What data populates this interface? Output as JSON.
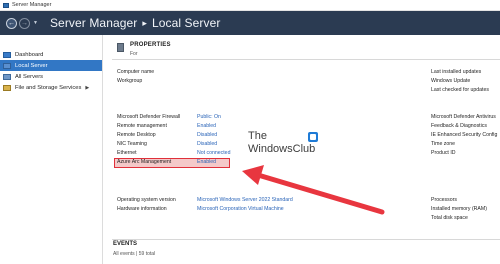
{
  "window": {
    "title": "Server Manager"
  },
  "header": {
    "back_icon": "back-arrow-icon",
    "forward_icon": "forward-arrow-icon",
    "breadcrumb_root": "Server Manager",
    "breadcrumb_sep": "▸",
    "breadcrumb_current": "Local Server",
    "band_color": "#2b3b52"
  },
  "sidebar": {
    "items": [
      {
        "label": "Dashboard",
        "icon": "dashboard-icon",
        "active": false
      },
      {
        "label": "Local Server",
        "icon": "local-server-icon",
        "active": true
      },
      {
        "label": "All Servers",
        "icon": "all-servers-icon",
        "active": false
      },
      {
        "label": "File and Storage Services",
        "icon": "file-storage-icon",
        "active": false,
        "has_chevron": true
      }
    ],
    "active_color": "#3277c5"
  },
  "properties": {
    "title": "PROPERTIES",
    "subtitle": "For",
    "left_rows_top": [
      {
        "label": "Computer name",
        "value": ""
      },
      {
        "label": "Workgroup",
        "value": ""
      }
    ],
    "left_rows_mid": [
      {
        "label": "Microsoft Defender Firewall",
        "value": "Public: On"
      },
      {
        "label": "Remote management",
        "value": "Enabled"
      },
      {
        "label": "Remote Desktop",
        "value": "Disabled"
      },
      {
        "label": "NIC Teaming",
        "value": "Disabled"
      },
      {
        "label": "Ethernet",
        "value": "Not connected"
      },
      {
        "label": "Azure Arc Management",
        "value": "Enabled"
      }
    ],
    "left_rows_bottom": [
      {
        "label": "Operating system version",
        "value": "Microsoft Windows Server 2022 Standard"
      },
      {
        "label": "Hardware information",
        "value": "Microsoft Corporation Virtual Machine"
      }
    ],
    "right_rows_top": [
      "Last installed updates",
      "Windows Update",
      "Last checked for updates"
    ],
    "right_rows_mid": [
      "Microsoft Defender Antivirus",
      "Feedback & Diagnostics",
      "IE Enhanced Security Config",
      "Time zone",
      "Product ID"
    ],
    "right_rows_bottom": [
      "Processors",
      "Installed memory (RAM)",
      "Total disk space"
    ],
    "highlight_color": "#e0303a"
  },
  "watermark": {
    "line1": "The",
    "line2": "WindowsClub"
  },
  "events": {
    "title": "EVENTS",
    "count": "All events | 59 total"
  }
}
